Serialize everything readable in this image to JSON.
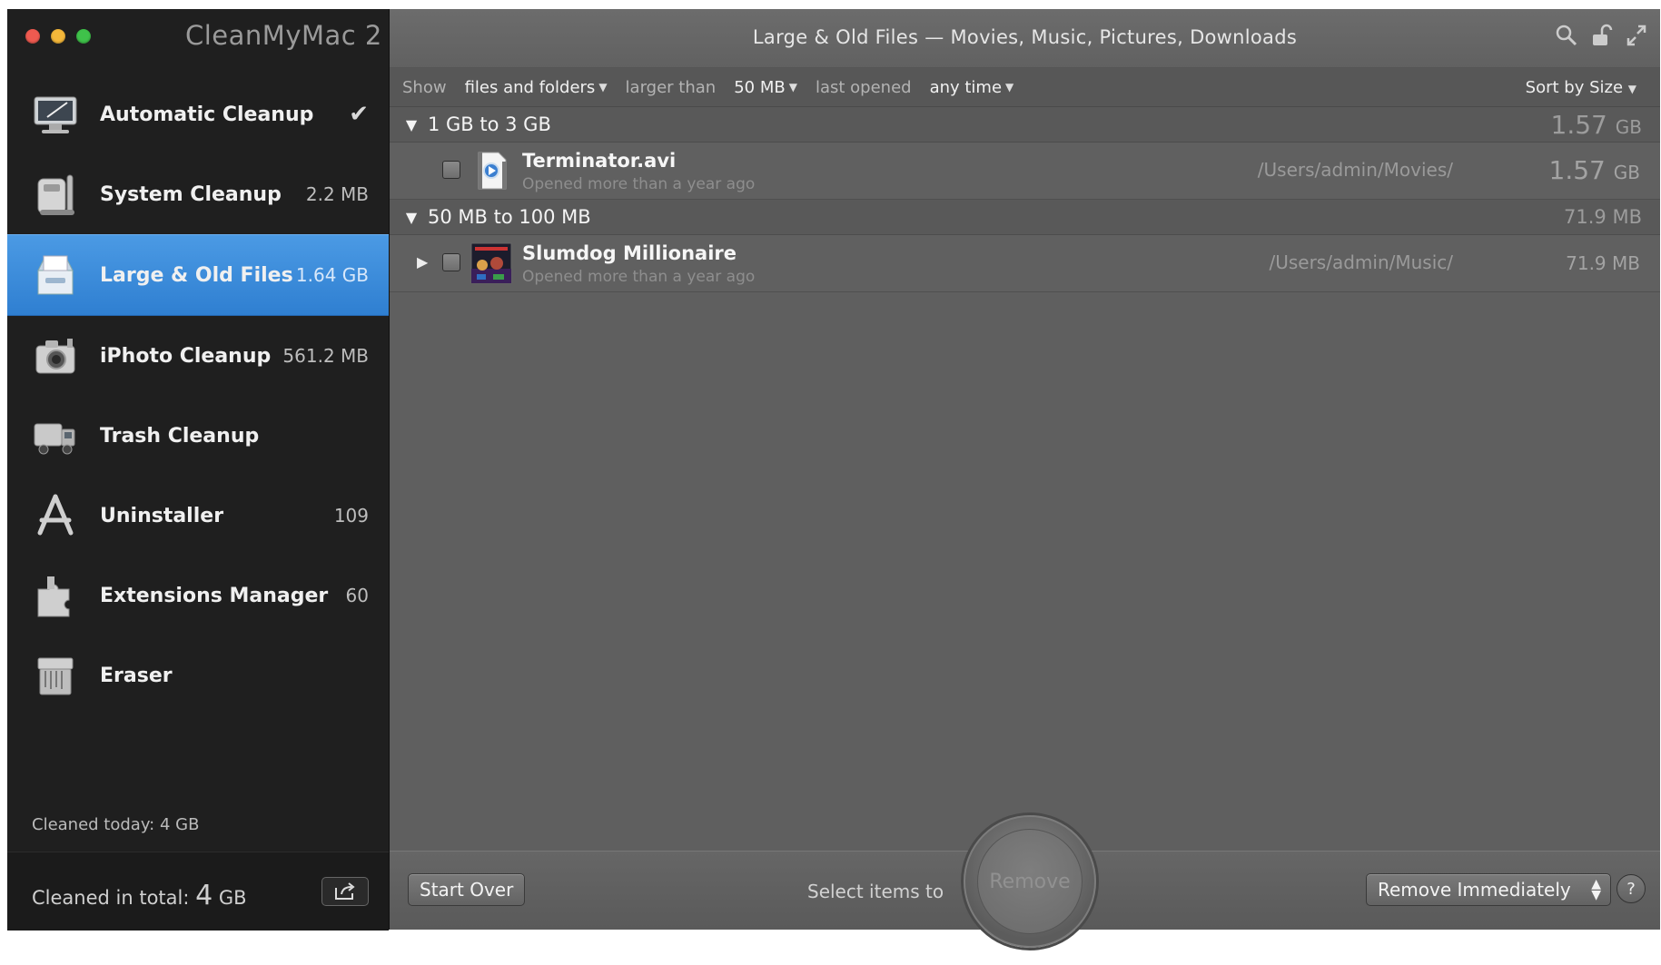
{
  "app": {
    "title": "CleanMyMac 2"
  },
  "sidebar": {
    "items": [
      {
        "label": "Automatic Cleanup",
        "value": "",
        "check": "✔"
      },
      {
        "label": "System Cleanup",
        "value": "2.2 MB"
      },
      {
        "label": "Large & Old Files",
        "value": "1.64 GB",
        "active": true
      },
      {
        "label": "iPhoto Cleanup",
        "value": "561.2 MB"
      },
      {
        "label": "Trash Cleanup",
        "value": ""
      },
      {
        "label": "Uninstaller",
        "value": "109"
      },
      {
        "label": "Extensions Manager",
        "value": "60"
      },
      {
        "label": "Eraser",
        "value": ""
      }
    ],
    "cleaned_today": "Cleaned today: 4 GB",
    "cleaned_total_label": "Cleaned in total:",
    "cleaned_total_num": "4",
    "cleaned_total_unit": "GB"
  },
  "titlebar": {
    "title": "Large & Old Files — Movies, Music, Pictures, Downloads"
  },
  "filter": {
    "show_label": "Show",
    "show_value": "files and folders",
    "larger_label": "larger than",
    "larger_value": "50 MB",
    "opened_label": "last opened",
    "opened_value": "any time",
    "sort": "Sort by Size"
  },
  "groups": [
    {
      "title": "1 GB to 3 GB",
      "size_num": "1.57",
      "size_unit": "GB",
      "file": {
        "name": "Terminator.avi",
        "sub": "Opened more than a year ago",
        "path": "/Users/admin/Movies/",
        "size_num": "1.57",
        "size_unit": "GB"
      }
    },
    {
      "title": "50 MB to 100 MB",
      "size": "71.9 MB",
      "file": {
        "name": "Slumdog Millionaire",
        "sub": "Opened more than a year ago",
        "path": "/Users/admin/Music/",
        "size": "71.9 MB"
      }
    }
  ],
  "bottom": {
    "start_over": "Start Over",
    "hint": "Select items to",
    "remove": "Remove",
    "mode": "Remove Immediately",
    "help": "?"
  }
}
